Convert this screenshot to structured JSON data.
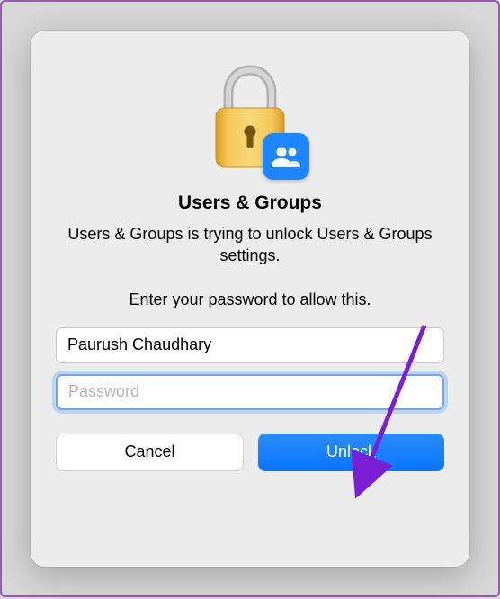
{
  "dialog": {
    "title": "Users & Groups",
    "message": "Users & Groups is trying to unlock Users & Groups settings.",
    "instruction": "Enter your password to allow this.",
    "username_value": "Paurush Chaudhary",
    "password_placeholder": "Password",
    "cancel_label": "Cancel",
    "unlock_label": "Unlock"
  }
}
